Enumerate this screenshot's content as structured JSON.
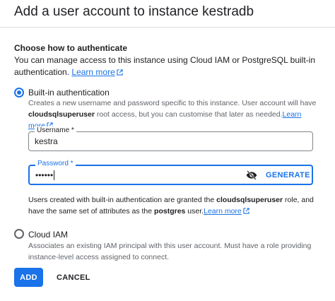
{
  "dialog": {
    "title": "Add a user account to instance kestradb"
  },
  "auth": {
    "section_title": "Choose how to authenticate",
    "section_desc": "You can manage access to this instance using Cloud IAM or PostgreSQL built-in authentication.",
    "learn_more": "Learn more",
    "builtin": {
      "label": "Built-in authentication",
      "selected": true,
      "desc_part1": "Creates a new username and password specific to this instance. User account will have",
      "desc_bold": "cloudsqlsuperuser",
      "desc_part2": "root access, but you can customise that later as needed.",
      "learn_more": "Learn more"
    },
    "username": {
      "label": "Username *",
      "value": "kestra"
    },
    "password": {
      "label": "Password *",
      "value": "••••••",
      "generate_label": "GENERATE",
      "visibility_icon": "visibility-off-icon"
    },
    "info": {
      "part1": "Users created with built-in authentication are granted the",
      "bold1": "cloudsqlsuperuser",
      "part2": "role, and have the same set of attributes as the",
      "bold2": "postgres",
      "part3": "user.",
      "learn_more": "Learn more"
    },
    "iam": {
      "label": "Cloud IAM",
      "selected": false,
      "desc": "Associates an existing IAM principal with this user account. Must have a role providing instance-level access assigned to connect."
    }
  },
  "actions": {
    "add_label": "ADD",
    "cancel_label": "CANCEL"
  },
  "colors": {
    "accent": "#1a73e8",
    "text": "#202124",
    "secondary_text": "#5f6368",
    "border": "#dadce0"
  }
}
